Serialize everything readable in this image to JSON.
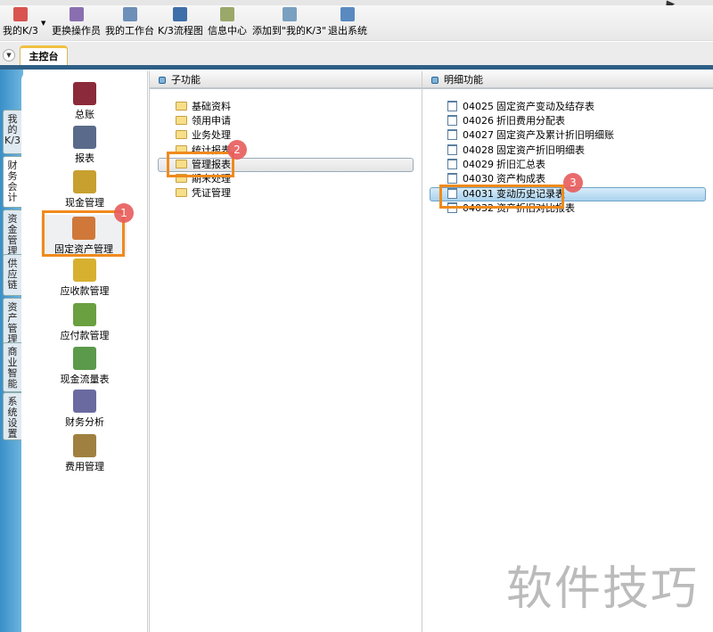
{
  "toolbar": {
    "items": [
      {
        "label": "我的K/3",
        "icon": "star-icon",
        "color": "#d9534f"
      },
      {
        "label": "更换操作员",
        "icon": "users-icon",
        "color": "#8a6fb0"
      },
      {
        "label": "我的工作台",
        "icon": "pen-icon",
        "color": "#6d8fb8"
      },
      {
        "label": "K/3流程图",
        "icon": "flowchart-icon",
        "color": "#3f6fa8"
      },
      {
        "label": "信息中心",
        "icon": "message-icon",
        "color": "#9aa86a"
      },
      {
        "label": "添加到\"我的K/3\"",
        "icon": "add-icon",
        "color": "#7aa0c0"
      },
      {
        "label": "退出系统",
        "icon": "exit-icon",
        "color": "#5a8ac0"
      }
    ]
  },
  "tabs": {
    "main": "主控台"
  },
  "side_tabs": [
    "我的K/3",
    "财务会计",
    "资金管理",
    "供应链",
    "资产管理",
    "商业智能",
    "系统设置"
  ],
  "modules": [
    {
      "label": "总账",
      "color": "#8b2a3a"
    },
    {
      "label": "报表",
      "color": "#5a6a8a"
    },
    {
      "label": "现金管理",
      "color": "#c8a030"
    },
    {
      "label": "固定资产管理",
      "color": "#d0783a"
    },
    {
      "label": "应收款管理",
      "color": "#d8b030"
    },
    {
      "label": "应付款管理",
      "color": "#6aa040"
    },
    {
      "label": "现金流量表",
      "color": "#5a9a4a"
    },
    {
      "label": "财务分析",
      "color": "#6a6aa0"
    },
    {
      "label": "费用管理",
      "color": "#a08040"
    }
  ],
  "sub_panel": {
    "title": "子功能",
    "items": [
      "基础资料",
      "领用申请",
      "业务处理",
      "统计报表",
      "管理报表",
      "期末处理",
      "凭证管理"
    ],
    "selected": "管理报表"
  },
  "detail_panel": {
    "title": "明细功能",
    "items": [
      {
        "code": "04025",
        "name": "固定资产变动及结存表"
      },
      {
        "code": "04026",
        "name": "折旧费用分配表"
      },
      {
        "code": "04027",
        "name": "固定资产及累计折旧明细账"
      },
      {
        "code": "04028",
        "name": "固定资产折旧明细表"
      },
      {
        "code": "04029",
        "name": "折旧汇总表"
      },
      {
        "code": "04030",
        "name": "资产构成表"
      },
      {
        "code": "04031",
        "name": "变动历史记录表"
      },
      {
        "code": "04032",
        "name": "资产折旧对比报表"
      }
    ],
    "selected": "04031"
  },
  "annotations": [
    "1",
    "2",
    "3"
  ],
  "watermark": "软件技巧"
}
